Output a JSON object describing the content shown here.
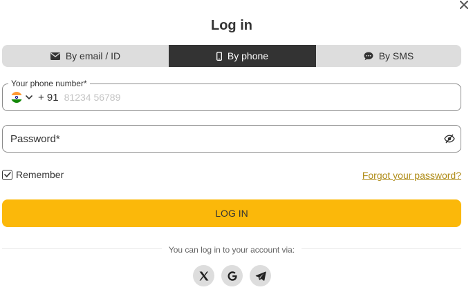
{
  "dialog": {
    "title": "Log in",
    "close_icon": "close-icon"
  },
  "tabs": [
    {
      "label": "By email / ID",
      "icon": "envelope-icon",
      "active": false
    },
    {
      "label": "By phone",
      "icon": "mobile-phone-icon",
      "active": true
    },
    {
      "label": "By SMS",
      "icon": "chat-bubble-icon",
      "active": false
    }
  ],
  "phone": {
    "label": "Your phone number*",
    "country_flag": "india-flag-icon",
    "country_code": "+ 91",
    "placeholder": "81234 56789"
  },
  "password": {
    "placeholder": "Password*",
    "toggle_icon": "eye-slash-icon"
  },
  "remember": {
    "label": "Remember",
    "checked": true
  },
  "forgot_link": "Forgot your password?",
  "login_button": "LOG IN",
  "social": {
    "caption": "You can log in to your account via:",
    "providers": [
      "x-icon",
      "google-icon",
      "telegram-icon"
    ]
  },
  "colors": {
    "accent": "#fbb80a",
    "active_tab": "#333333",
    "tab_bg": "#dddddd",
    "link": "#b08d1a"
  }
}
